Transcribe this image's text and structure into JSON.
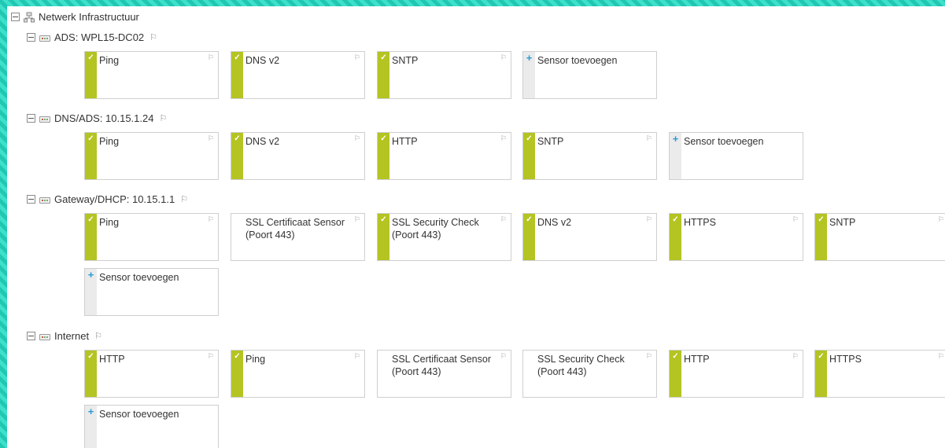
{
  "root": {
    "label": "Netwerk Infrastructuur"
  },
  "icons": {
    "toggle": "collapse-box-icon",
    "network": "network-icon",
    "device": "device-icon",
    "flag": "⚐",
    "ok": "✓",
    "warning": "W",
    "add": "+"
  },
  "colors": {
    "ok": "#b4c422",
    "warning": "#f6c500",
    "add": "#2a9ad6",
    "background": "#3fe0c9"
  },
  "devices": [
    {
      "label": "ADS: WPL15-DC02",
      "sensors": [
        {
          "name": "Ping",
          "status": "ok"
        },
        {
          "name": "DNS v2",
          "status": "ok"
        },
        {
          "name": "SNTP",
          "status": "ok"
        },
        {
          "name": "Sensor toevoegen",
          "status": "add"
        }
      ]
    },
    {
      "label": "DNS/ADS: 10.15.1.24",
      "sensors": [
        {
          "name": "Ping",
          "status": "ok"
        },
        {
          "name": "DNS v2",
          "status": "ok"
        },
        {
          "name": "HTTP",
          "status": "ok"
        },
        {
          "name": "SNTP",
          "status": "ok"
        },
        {
          "name": "Sensor toevoegen",
          "status": "add"
        }
      ]
    },
    {
      "label": "Gateway/DHCP: 10.15.1.1",
      "sensors": [
        {
          "name": "Ping",
          "status": "ok"
        },
        {
          "name": "SSL Certificaat Sensor (Poort 443)",
          "status": "warning"
        },
        {
          "name": "SSL Security Check (Poort 443)",
          "status": "ok"
        },
        {
          "name": "DNS v2",
          "status": "ok"
        },
        {
          "name": "HTTPS",
          "status": "ok"
        },
        {
          "name": "SNTP",
          "status": "ok"
        },
        {
          "name": "Sensor toevoegen",
          "status": "add"
        }
      ]
    },
    {
      "label": "Internet",
      "sensors": [
        {
          "name": "HTTP",
          "status": "ok"
        },
        {
          "name": "Ping",
          "status": "ok"
        },
        {
          "name": "SSL Certificaat Sensor (Poort 443)",
          "status": "warning"
        },
        {
          "name": "SSL Security Check (Poort 443)",
          "status": "warning"
        },
        {
          "name": "HTTP",
          "status": "ok"
        },
        {
          "name": "HTTPS",
          "status": "ok"
        },
        {
          "name": "Sensor toevoegen",
          "status": "add"
        }
      ]
    }
  ]
}
